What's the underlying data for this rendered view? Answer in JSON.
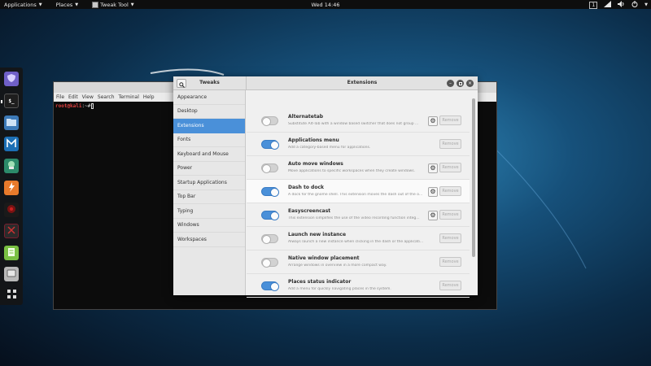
{
  "topbar": {
    "applications": "Applications",
    "places": "Places",
    "app_name": "Tweak Tool",
    "clock": "Wed 14:46",
    "workspace": "1"
  },
  "dock": {
    "items": [
      {
        "name": "dock-item-app-1",
        "icon": "shield-logo-icon",
        "color": "#6f5fc7"
      },
      {
        "name": "dock-item-terminal",
        "icon": "terminal-icon",
        "color": "#1e1e1e"
      },
      {
        "name": "dock-item-files",
        "icon": "folder-icon",
        "color": "#3d7ab8"
      },
      {
        "name": "dock-item-metasploit",
        "icon": "metasploit-icon",
        "color": "#1c6fb5"
      },
      {
        "name": "dock-item-armitage",
        "icon": "armitage-icon",
        "color": "#2c8a6a"
      },
      {
        "name": "dock-item-burpsuite",
        "icon": "burpsuite-icon",
        "color": "#e87a2b"
      },
      {
        "name": "dock-item-app-7",
        "icon": "red-circle-icon",
        "color": "#7a1212"
      },
      {
        "name": "dock-item-app-8",
        "icon": "app-icon",
        "color": "#7a1f2e"
      },
      {
        "name": "dock-item-notes",
        "icon": "notes-icon",
        "color": "#7ac143"
      },
      {
        "name": "dock-item-app-10",
        "icon": "app-icon",
        "color": "#9a9a9a"
      },
      {
        "name": "dock-item-show-apps",
        "icon": "grid-icon",
        "color": "#2a2a2a"
      }
    ]
  },
  "terminal": {
    "menu": [
      "File",
      "Edit",
      "View",
      "Search",
      "Terminal",
      "Help"
    ],
    "prompt_user": "root@kali",
    "prompt_rest": ":~#"
  },
  "tweaks": {
    "left_title": "Tweaks",
    "main_title": "Extensions",
    "categories": [
      {
        "label": "Appearance",
        "selected": false
      },
      {
        "label": "Desktop",
        "selected": false
      },
      {
        "label": "Extensions",
        "selected": true
      },
      {
        "label": "Fonts",
        "selected": false
      },
      {
        "label": "Keyboard and Mouse",
        "selected": false
      },
      {
        "label": "Power",
        "selected": false
      },
      {
        "label": "Startup Applications",
        "selected": false
      },
      {
        "label": "Top Bar",
        "selected": false
      },
      {
        "label": "Typing",
        "selected": false
      },
      {
        "label": "Windows",
        "selected": false
      },
      {
        "label": "Workspaces",
        "selected": false
      }
    ],
    "remove_label": "Remove",
    "extensions": [
      {
        "name": "Alternatetab",
        "desc": "Substitute Alt-Tab with a window based switcher that does not group ...",
        "enabled": false,
        "settings": true
      },
      {
        "name": "Applications menu",
        "desc": "Add a category-based menu for applications.",
        "enabled": true,
        "settings": false
      },
      {
        "name": "Auto move windows",
        "desc": "Move applications to specific workspaces when they create windows.",
        "enabled": false,
        "settings": true
      },
      {
        "name": "Dash to dock",
        "desc": "A dock for the gnome shell. This extension moves the dash out of the o...",
        "enabled": true,
        "settings": true
      },
      {
        "name": "Easyscreencast",
        "desc": "This extension simplifies the use of the video recording function integ...",
        "enabled": true,
        "settings": true
      },
      {
        "name": "Launch new instance",
        "desc": "Always launch a new instance when clicking in the dash or the application view.",
        "enabled": false,
        "settings": false
      },
      {
        "name": "Native window placement",
        "desc": "Arrange windows in overview in a more compact way.",
        "enabled": false,
        "settings": false
      },
      {
        "name": "Places status indicator",
        "desc": "Add a menu for quickly navigating places in the system.",
        "enabled": true,
        "settings": false
      }
    ]
  }
}
